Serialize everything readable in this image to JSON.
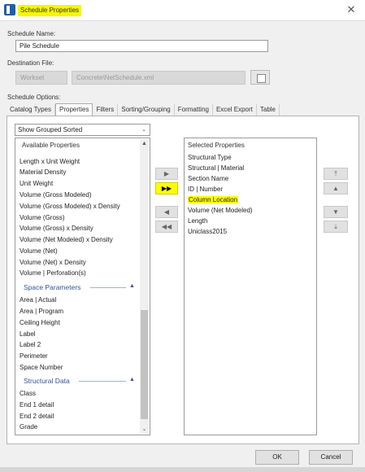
{
  "window": {
    "title": "Schedule Properties",
    "close_label": "✕"
  },
  "schedule_name": {
    "label": "Schedule Name:",
    "value": "Pile Schedule"
  },
  "destination": {
    "label": "Destination File:",
    "workset": "Workset",
    "path": "Concrete\\NetSchedule.xml"
  },
  "options_label": "Schedule Options:",
  "tabs": [
    {
      "label": "Catalog Types"
    },
    {
      "label": "Properties"
    },
    {
      "label": "Filters"
    },
    {
      "label": "Sorting/Grouping"
    },
    {
      "label": "Formatting"
    },
    {
      "label": "Excel Export"
    },
    {
      "label": "Table"
    }
  ],
  "filter_dropdown": {
    "value": "Show Grouped Sorted",
    "chevron": "⌄"
  },
  "available": {
    "header": "Available Properties",
    "items_top": [
      "Length x Unit Weight",
      "Material Density",
      "Unit Weight",
      "Volume (Gross Modeled)",
      "Volume (Gross Modeled) x Density",
      "Volume (Gross)",
      "Volume (Gross) x Density",
      "Volume (Net Modeled) x Density",
      "Volume (Net)",
      "Volume (Net) x Density",
      "Volume | Perforation(s)"
    ],
    "group_space": "Space Parameters",
    "items_space": [
      "Area | Actual",
      "Area | Program",
      "Ceiling Height",
      "Label",
      "Label 2",
      "Perimeter",
      "Space Number"
    ],
    "group_structural": "Structural Data",
    "items_structural": [
      "Class",
      "End 1 detail",
      "End 2 detail",
      "Grade"
    ],
    "collapse_glyph": "▲"
  },
  "transfer_buttons": {
    "add": "▶",
    "add_all": "▶▶",
    "remove": "◀",
    "remove_all": "◀◀"
  },
  "selected": {
    "header": "Selected Properties",
    "items": [
      "Structural Type",
      "Structural | Material",
      "Section Name",
      "ID | Number",
      "Column Location",
      "Volume (Net Modeled)",
      "Length",
      "Uniclass2015"
    ],
    "highlighted_item": "Column Location"
  },
  "order_buttons": {
    "top": "⤒",
    "up": "▲",
    "down": "▼",
    "bottom": "⤓"
  },
  "footer": {
    "ok": "OK",
    "cancel": "Cancel"
  },
  "scroll": {
    "up": "▲",
    "down": "⌄"
  },
  "colors": {
    "highlight": "#ffff00",
    "group_text": "#2f5597"
  }
}
